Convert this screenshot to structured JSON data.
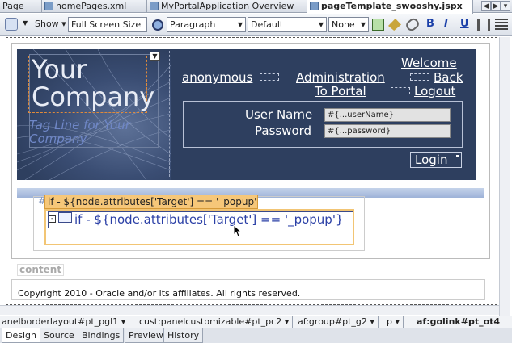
{
  "tabs": {
    "items": [
      {
        "label": "Page"
      },
      {
        "label": "homePages.xml"
      },
      {
        "label": "MyPortalApplication Overview"
      },
      {
        "label": "pageTemplate_swooshy.jspx"
      }
    ]
  },
  "toolbar": {
    "show_label": "Show",
    "screen_size": "Full Screen Size",
    "block_format": "Paragraph",
    "font": "Default",
    "size": "None",
    "bold": "B",
    "italic": "I",
    "underline": "U"
  },
  "banner": {
    "company_line1": "Your",
    "company_line2": "Company",
    "tagline": "Tag Line for Your Company",
    "welcome": "Welcome",
    "anonymous": "anonymous",
    "administration": "Administration",
    "back": "Back",
    "to_portal": "To Portal",
    "logout": "Logout",
    "username_label": "User Name",
    "username_value": "#{...userName}",
    "password_label": "Password",
    "password_value": "#{...password}",
    "login": "Login"
  },
  "loop": {
    "tag_label": "if - ${node.attributes['Target'] == '_popup'}",
    "if_text": "if - ${node.attributes['Target'] == '_popup'}",
    "hash": "#"
  },
  "content_label": "content",
  "copyright": "Copyright 2010 - Oracle and/or its affiliates. All rights reserved.",
  "breadcrumb": [
    {
      "label": "anelborderlayout#pt_pgl1"
    },
    {
      "label": "cust:panelcustomizable#pt_pc2"
    },
    {
      "label": "af:group#pt_g2"
    },
    {
      "label": "p"
    },
    {
      "label": "af:golink#pt_ot4"
    }
  ],
  "bottom_tabs": [
    {
      "label": "Design"
    },
    {
      "label": "Source"
    },
    {
      "label": "Bindings"
    },
    {
      "label": "Preview"
    },
    {
      "label": "History"
    }
  ]
}
